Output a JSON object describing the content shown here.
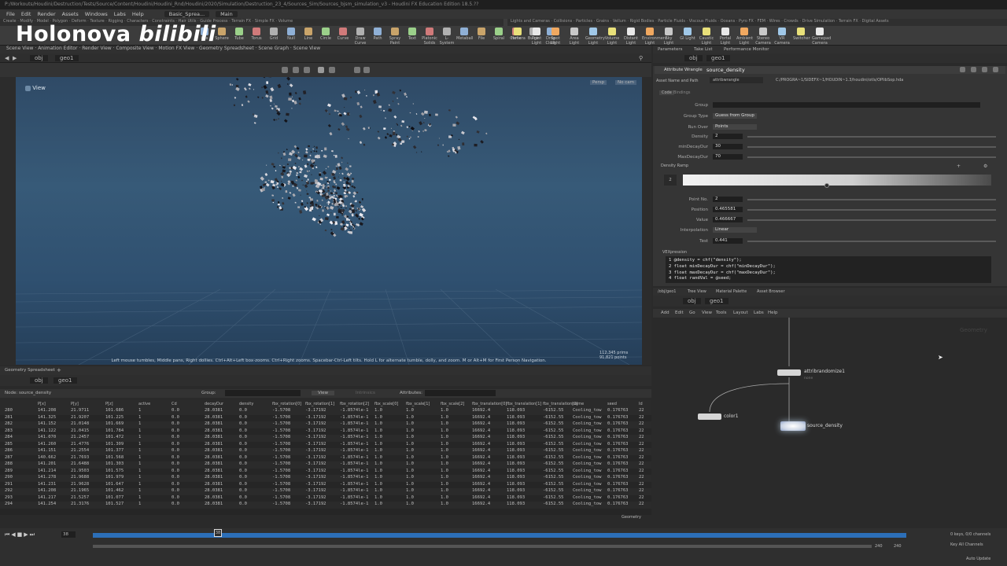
{
  "window": {
    "title": "P:/Workouts/Houdini/Destruction/Tests/Source/Content/Houdini/Houdini_Rnd/Houdini/2020/Simulation/Destruction_23_4/Sources_Sim/Sources_bjsm_simulation_v3 - Houdini FX Education Edition 18.5.??"
  },
  "watermark": {
    "text1": "Holonova",
    "text2": "bilibili"
  },
  "menu": [
    "File",
    "Edit",
    "Render",
    "Assets",
    "Windows",
    "Labs",
    "Help"
  ],
  "desktop": {
    "name": "Basic_Sprea...",
    "main": "Main"
  },
  "shelf_tabs_left": [
    "Create",
    "Modify",
    "Model",
    "Polygon",
    "Deform",
    "Texture",
    "Rigging",
    "Characters",
    "Constraints",
    "Hair Utils",
    "Guide Process",
    "Terrain FX",
    "Simple FX",
    "Volume"
  ],
  "shelf_tabs_right": [
    "Lights and Cameras",
    "Collisions",
    "Particles",
    "Grains",
    "Vellum",
    "Rigid Bodies",
    "Particle Fluids",
    "Viscous Fluids",
    "Oceans",
    "Pyro FX",
    "FEM",
    "Wires",
    "Crowds",
    "Drive Simulation",
    "Terrain FX",
    "Digital Assets"
  ],
  "shelf_tools_left": [
    "Box",
    "Sphere",
    "Tube",
    "Torus",
    "Grid",
    "Null",
    "Line",
    "Circle",
    "Curve",
    "Draw Curve",
    "Path",
    "Spray Paint",
    "Text",
    "Platonic Solids",
    "L-System",
    "Metaball",
    "File",
    "Spiral",
    "Helix",
    "Bulge",
    "Drop Cloth"
  ],
  "shelf_tools_right": [
    "Camera",
    "Point Light",
    "Spot Light",
    "Area Light",
    "Geometry Light",
    "Volume Light",
    "Distant Light",
    "Environment Light",
    "Sky Light",
    "GI Light",
    "Caustic Light",
    "Portal Light",
    "Ambient Light",
    "Stereo Camera",
    "VR Camera",
    "Switcher",
    "Gamepad Camera"
  ],
  "left_pane": {
    "tabs": [
      "Scene View",
      "Animation Editor",
      "Render View",
      "Composite View",
      "Motion FX View",
      "Geometry Spreadsheet",
      "Scene Graph",
      "Scene View"
    ],
    "path": [
      "obj",
      "geo1"
    ],
    "viewport_label": "View",
    "camera_menu": "Persp",
    "cam_menu2": "No cam",
    "nav_hint": "Left mouse tumbles, Middle pans, Right dollies. Ctrl+Alt+Left box-zooms. Ctrl+Right zooms. Spacebar-Ctrl-Left tilts. Hold L for alternate tumble, dolly, and zoom. M or Alt+M for First Person Navigation.",
    "stats": [
      "112,345 prims",
      "91,821 points"
    ]
  },
  "spreadsheet": {
    "tab": "Geometry Spreadsheet",
    "path": [
      "obj",
      "geo1"
    ],
    "node": "Node: source_density",
    "group_label": "Group:",
    "view_label": "View",
    "attrib_label": "Attributes:",
    "intrinsics": "Intrinsics",
    "columns": [
      "",
      "P[x]",
      "P[y]",
      "P[z]",
      "active",
      "Cd",
      "decayDur",
      "density",
      "fbx_rotation[0]",
      "fbx_rotation[1]",
      "fbx_rotation[2]",
      "fbx_scale[0]",
      "fbx_scale[1]",
      "fbx_scale[2]",
      "fbx_translation[0]",
      "fbx_translation[1]",
      "fbx_translation[2]",
      "name",
      "seed",
      "Id"
    ],
    "rows": [
      [
        "280",
        "141.208",
        "21.9711",
        "101.686",
        "1",
        "0.0",
        "28.0381",
        "0.0",
        "-1.5708",
        "-3.17192",
        "-1.8574le-1",
        "1.0",
        "1.0",
        "1.0",
        "16692.4",
        "118.093",
        "-6152.55",
        "Cooling_tow",
        "0.176763",
        "22"
      ],
      [
        "281",
        "141.325",
        "21.9207",
        "101.225",
        "1",
        "0.0",
        "28.0381",
        "0.0",
        "-1.5708",
        "-3.17192",
        "-1.8574le-1",
        "1.0",
        "1.0",
        "1.0",
        "16692.4",
        "118.093",
        "-6152.55",
        "Cooling_tow",
        "0.176763",
        "22"
      ],
      [
        "282",
        "141.152",
        "21.0148",
        "101.669",
        "1",
        "0.0",
        "28.0381",
        "0.0",
        "-1.5708",
        "-3.17192",
        "-1.8574le-1",
        "1.0",
        "1.0",
        "1.0",
        "16692.4",
        "118.093",
        "-6152.55",
        "Cooling_tow",
        "0.176763",
        "22"
      ],
      [
        "283",
        "141.122",
        "21.0415",
        "101.784",
        "1",
        "0.0",
        "28.0381",
        "0.0",
        "-1.5708",
        "-3.17192",
        "-1.8574le-1",
        "1.0",
        "1.0",
        "1.0",
        "16692.4",
        "118.093",
        "-6152.55",
        "Cooling_tow",
        "0.176763",
        "22"
      ],
      [
        "284",
        "141.070",
        "21.2457",
        "101.472",
        "1",
        "0.0",
        "28.0381",
        "0.0",
        "-1.5708",
        "-3.17192",
        "-1.8574le-1",
        "1.0",
        "1.0",
        "1.0",
        "16692.4",
        "118.093",
        "-6152.55",
        "Cooling_tow",
        "0.176763",
        "22"
      ],
      [
        "285",
        "141.260",
        "21.4776",
        "101.309",
        "1",
        "0.0",
        "28.0381",
        "0.0",
        "-1.5708",
        "-3.17192",
        "-1.8574le-1",
        "1.0",
        "1.0",
        "1.0",
        "16692.4",
        "118.093",
        "-6152.55",
        "Cooling_tow",
        "0.176763",
        "22"
      ],
      [
        "286",
        "141.151",
        "21.2554",
        "101.377",
        "1",
        "0.0",
        "28.0381",
        "0.0",
        "-1.5708",
        "-3.17192",
        "-1.8574le-1",
        "1.0",
        "1.0",
        "1.0",
        "16692.4",
        "118.093",
        "-6152.55",
        "Cooling_tow",
        "0.176763",
        "22"
      ],
      [
        "287",
        "140.662",
        "21.7693",
        "101.568",
        "1",
        "0.0",
        "28.0381",
        "0.0",
        "-1.5708",
        "-3.17192",
        "-1.8574le-1",
        "1.0",
        "1.0",
        "1.0",
        "16692.4",
        "118.093",
        "-6152.55",
        "Cooling_tow",
        "0.176763",
        "22"
      ],
      [
        "288",
        "141.201",
        "21.6488",
        "101.303",
        "1",
        "0.0",
        "28.0381",
        "0.0",
        "-1.5708",
        "-3.17192",
        "-1.8574le-1",
        "1.0",
        "1.0",
        "1.0",
        "16692.4",
        "118.093",
        "-6152.55",
        "Cooling_tow",
        "0.176763",
        "22"
      ],
      [
        "289",
        "141.214",
        "21.9503",
        "101.575",
        "1",
        "0.0",
        "28.0381",
        "0.0",
        "-1.5708",
        "-3.17192",
        "-1.8574le-1",
        "1.0",
        "1.0",
        "1.0",
        "16692.4",
        "118.093",
        "-6152.55",
        "Cooling_tow",
        "0.176763",
        "22"
      ],
      [
        "290",
        "141.278",
        "21.9688",
        "101.979",
        "1",
        "0.0",
        "28.0381",
        "0.0",
        "-1.5708",
        "-3.17192",
        "-1.8574le-1",
        "1.0",
        "1.0",
        "1.0",
        "16692.4",
        "118.093",
        "-6152.55",
        "Cooling_tow",
        "0.176763",
        "22"
      ],
      [
        "291",
        "141.231",
        "21.9628",
        "101.647",
        "1",
        "0.0",
        "28.0381",
        "0.0",
        "-1.5708",
        "-3.17192",
        "-1.8574le-1",
        "1.0",
        "1.0",
        "1.0",
        "16692.4",
        "118.093",
        "-6152.55",
        "Cooling_tow",
        "0.176763",
        "22"
      ],
      [
        "292",
        "141.208",
        "21.1965",
        "101.462",
        "1",
        "0.0",
        "28.0381",
        "0.0",
        "-1.5708",
        "-3.17192",
        "-1.8574le-1",
        "1.0",
        "1.0",
        "1.0",
        "16692.4",
        "118.093",
        "-6152.55",
        "Cooling_tow",
        "0.176763",
        "22"
      ],
      [
        "293",
        "141.217",
        "21.5257",
        "101.077",
        "1",
        "0.0",
        "28.0381",
        "0.0",
        "-1.5708",
        "-3.17192",
        "-1.8574le-1",
        "1.0",
        "1.0",
        "1.0",
        "16692.4",
        "118.093",
        "-6152.55",
        "Cooling_tow",
        "0.176763",
        "22"
      ],
      [
        "294",
        "141.254",
        "21.3176",
        "101.527",
        "1",
        "0.0",
        "28.0381",
        "0.0",
        "-1.5708",
        "-3.17192",
        "-1.8574le-1",
        "1.0",
        "1.0",
        "1.0",
        "16692.4",
        "118.093",
        "-6152.55",
        "Cooling_tow",
        "0.176763",
        "22"
      ]
    ]
  },
  "params": {
    "tabs": [
      "Parameters",
      "Take List",
      "Performance Monitor"
    ],
    "path": [
      "obj",
      "geo1"
    ],
    "node_type": "Attribute Wrangle",
    "node_name": "source_density",
    "asset_label": "Asset Name and Path",
    "asset_name": "attribwrangle",
    "asset_path": "C:/PROGRA~1/SIDEFX~1/HOUDIN~1.3/houdini/otls/OPlibSop.hda",
    "subtabs": [
      "Code",
      "Bindings"
    ],
    "fields": [
      {
        "label": "Group",
        "value": ""
      },
      {
        "label": "Group Type",
        "value": "Guess from Group"
      },
      {
        "label": "Run Over",
        "value": "Points"
      },
      {
        "label": "Density",
        "value": "2"
      },
      {
        "label": "minDecayDur",
        "value": "30"
      },
      {
        "label": "MaxDecayDur",
        "value": "70"
      }
    ],
    "ramp_label": "Density Ramp",
    "ramp_count": "2",
    "ramp": [
      {
        "label": "Point No.",
        "value": "2"
      },
      {
        "label": "Position",
        "value": "0.465581"
      },
      {
        "label": "Value",
        "value": "0.466667"
      },
      {
        "label": "Interpolation",
        "value": "Linear"
      }
    ],
    "test_label": "Test",
    "test_value": "0.441",
    "vex_label": "VEXpression",
    "code": [
      "1 @density = chf(\"density\");",
      "2 float minDecayDur = chf(\"minDecayDur\");",
      "3 float maxDecayDur = chf(\"maxDecayDur\");",
      "4 float randVal = @seed;"
    ]
  },
  "network": {
    "tabs": [
      "/obj/geo1",
      "Tree View",
      "Material Palette",
      "Asset Browser"
    ],
    "path": [
      "obj",
      "geo1"
    ],
    "menu": [
      "Add",
      "Edit",
      "Go",
      "View",
      "Tools",
      "Layout",
      "Labs",
      "Help"
    ],
    "context": "Geometry",
    "nodes": [
      {
        "name": "attribrandomize1",
        "color": "#d6d6d6"
      },
      {
        "name": "color1",
        "color": "#d6d6d6"
      },
      {
        "name": "source_density",
        "color": "#e8e8e8"
      }
    ],
    "sub_label": "none"
  },
  "timeline": {
    "frame": "38",
    "start": "1",
    "current_marker": "38",
    "end_a": "240",
    "end_b": "240",
    "keys_label": "0 keys, 0/0 channels",
    "key_all": "Key All Channels",
    "auto_update": "Auto Update",
    "status": "Geometry"
  },
  "colors": {
    "accent": "#2c6fb8",
    "viewport_top": "#2f4a66",
    "node_selected": "#e8e8e8"
  }
}
